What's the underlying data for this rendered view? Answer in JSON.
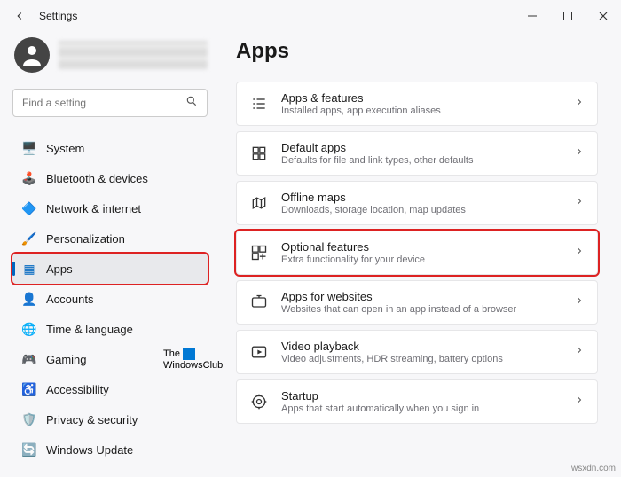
{
  "window": {
    "title": "Settings"
  },
  "search": {
    "placeholder": "Find a setting"
  },
  "sidebar": {
    "items": [
      {
        "label": "System",
        "icon": "🖥️",
        "color": "#0067c0"
      },
      {
        "label": "Bluetooth & devices",
        "icon": "🕹️",
        "color": "#0067c0"
      },
      {
        "label": "Network & internet",
        "icon": "🔷",
        "color": "#0aa3d6"
      },
      {
        "label": "Personalization",
        "icon": "🖌️",
        "color": "#d58b2b"
      },
      {
        "label": "Apps",
        "icon": "▦",
        "color": "#0067c0"
      },
      {
        "label": "Accounts",
        "icon": "👤",
        "color": "#2ba84a"
      },
      {
        "label": "Time & language",
        "icon": "🌐",
        "color": "#0aa3d6"
      },
      {
        "label": "Gaming",
        "icon": "🎮",
        "color": "#444"
      },
      {
        "label": "Accessibility",
        "icon": "♿",
        "color": "#0067c0"
      },
      {
        "label": "Privacy & security",
        "icon": "🛡️",
        "color": "#555"
      },
      {
        "label": "Windows Update",
        "icon": "🔄",
        "color": "#0067c0"
      }
    ],
    "active_index": 4
  },
  "page": {
    "title": "Apps"
  },
  "cards": [
    {
      "title": "Apps & features",
      "subtitle": "Installed apps, app execution aliases"
    },
    {
      "title": "Default apps",
      "subtitle": "Defaults for file and link types, other defaults"
    },
    {
      "title": "Offline maps",
      "subtitle": "Downloads, storage location, map updates"
    },
    {
      "title": "Optional features",
      "subtitle": "Extra functionality for your device"
    },
    {
      "title": "Apps for websites",
      "subtitle": "Websites that can open in an app instead of a browser"
    },
    {
      "title": "Video playback",
      "subtitle": "Video adjustments, HDR streaming, battery options"
    },
    {
      "title": "Startup",
      "subtitle": "Apps that start automatically when you sign in"
    }
  ],
  "highlight_card_index": 3,
  "watermark": {
    "line1": "The",
    "line2": "WindowsClub"
  },
  "corner": "wsxdn.com"
}
